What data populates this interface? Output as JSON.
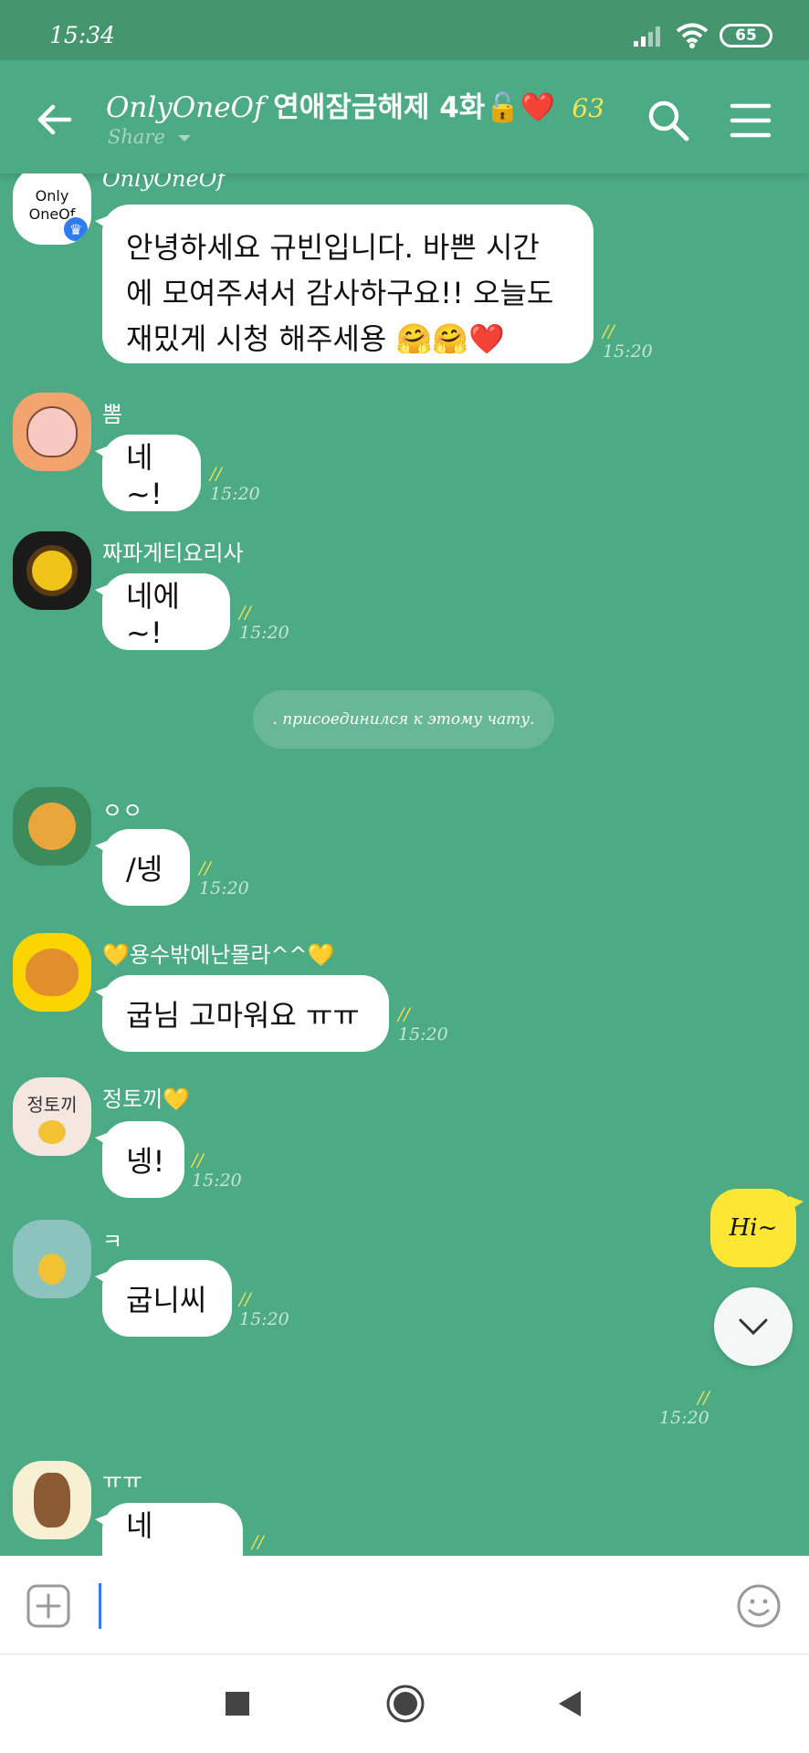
{
  "status": {
    "time": "15:34",
    "battery": "65"
  },
  "header": {
    "title_latin": "OnlyOneOf",
    "title_korean": "연애잠금해제 4화🔓❤️",
    "member_count": "63",
    "share_label": "Share"
  },
  "notice": ". присоединился к этому чату.",
  "messages": [
    {
      "sender": "OnlyOneOf",
      "avatar_text": "Only OneOf",
      "lines": [
        "안녕하세요 규빈입니다. 바쁜 시간",
        "에 모여주셔서 감사하구요!! 오늘도",
        "재밌게 시청 해주세용 🤗🤗❤️"
      ],
      "read_count": "//",
      "time": "15:20"
    },
    {
      "sender": "뽐",
      "text": "네~!",
      "read_count": "//",
      "time": "15:20"
    },
    {
      "sender": "짜파게티요리사",
      "text": "네에~!",
      "read_count": "//",
      "time": "15:20"
    },
    {
      "sender": "ㅇㅇ",
      "text": "/넹",
      "read_count": "//",
      "time": "15:20"
    },
    {
      "sender": "💛용수밖에난몰라^^💛",
      "text": "굽님 고마워요 ㅠㅠ",
      "read_count": "//",
      "time": "15:20"
    },
    {
      "sender": "정토끼💛",
      "avatar_text": "정토끼",
      "text": "넹!",
      "read_count": "//",
      "time": "15:20"
    },
    {
      "sender": "ㅋ",
      "text": "굽니씨",
      "read_count": "//",
      "time": "15:20"
    },
    {
      "sender": "ㅠㅠ",
      "text": "네~~~~",
      "read_count": "//"
    }
  ],
  "my_message": {
    "text": "Hi~",
    "read_count": "//",
    "time": "15:20"
  },
  "colors": {
    "background": "#4caa84",
    "my_bubble": "#fde636",
    "read_count": "#f3e455"
  }
}
